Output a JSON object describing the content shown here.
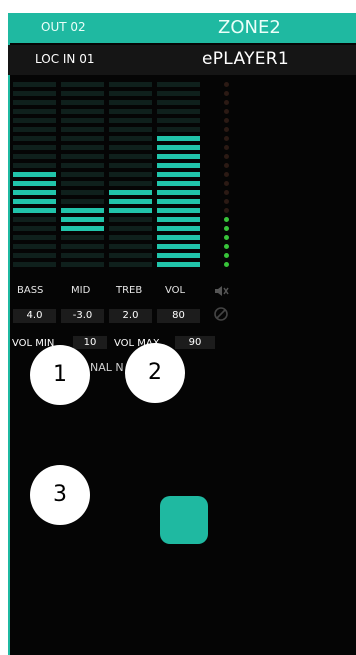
{
  "header": {
    "out": "OUT 02",
    "zone": "ZONE2"
  },
  "subheader": {
    "input": "LOC IN 01",
    "player": "ePLAYER1"
  },
  "eq": {
    "labels": [
      "BASS",
      "MID",
      "TREB",
      "VOL"
    ],
    "values": [
      "4.0",
      "-3.0",
      "2.0",
      "80"
    ],
    "active_segments": [
      [
        10,
        11,
        12,
        13,
        14
      ],
      [
        14,
        15,
        16
      ],
      [
        12,
        13,
        14
      ],
      [
        6,
        7,
        8,
        9,
        10,
        11,
        12,
        13,
        14,
        15,
        16,
        17,
        18,
        19,
        20
      ]
    ]
  },
  "volume": {
    "min_label": "VOL MIN",
    "min_value": "10",
    "max_label": "VOL MAX",
    "max_value": "90"
  },
  "hidden_label_fragment": "NAL N",
  "badges": [
    "1",
    "2",
    "3"
  ],
  "colors": {
    "accent": "#1fb9a1",
    "background": "#050505",
    "meter_green": "#38c43a"
  }
}
